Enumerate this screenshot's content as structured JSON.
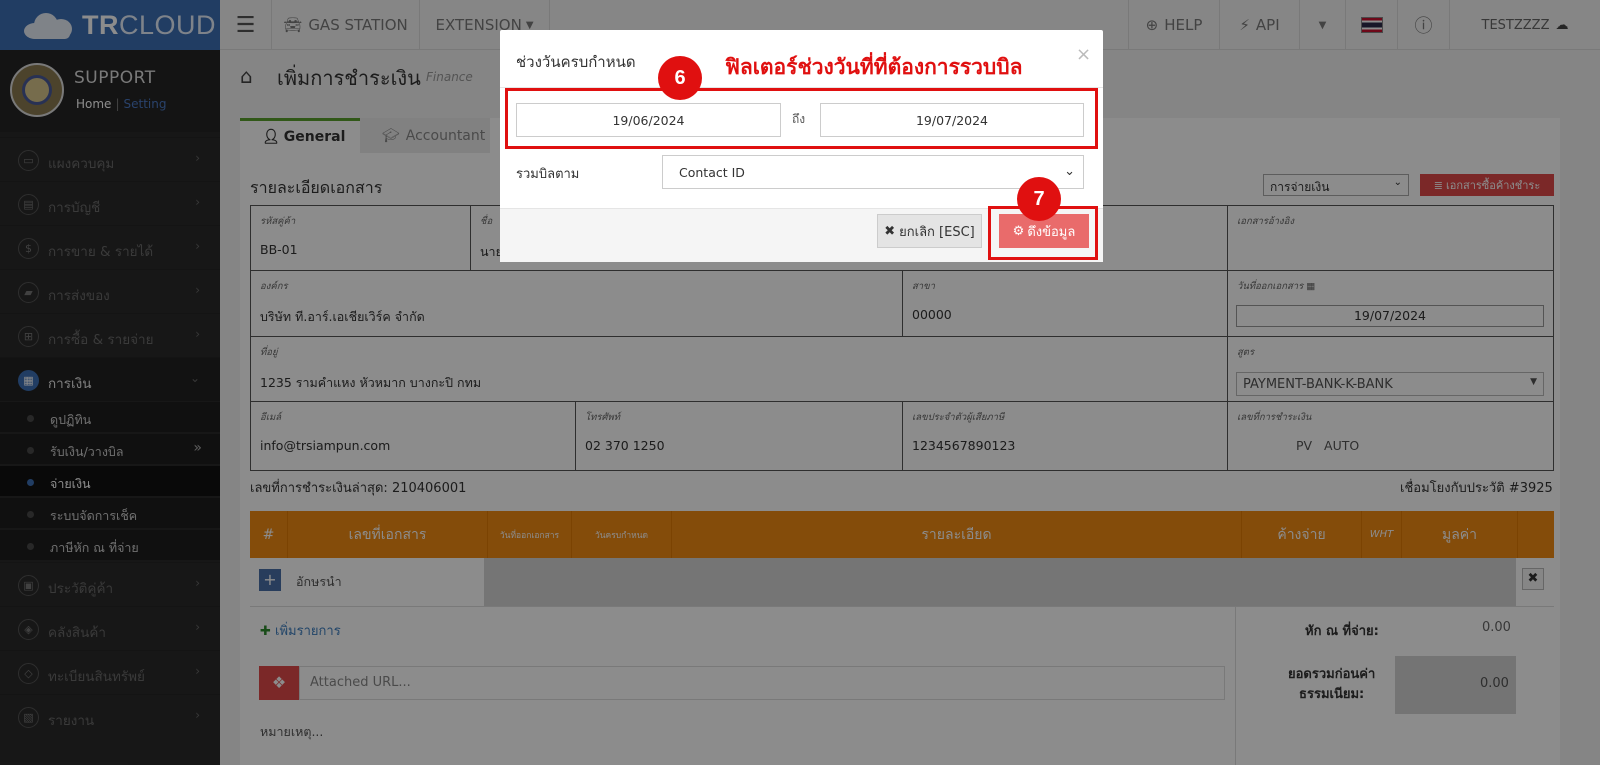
{
  "brand": {
    "bold": "TR",
    "light": "CLOUD"
  },
  "profile": {
    "name": "SUPPORT",
    "home": "Home",
    "separator": "|",
    "setting": "Setting"
  },
  "sidebar": {
    "menu": [
      {
        "label": "แผงควบคุม",
        "icon": "monitor-icon"
      },
      {
        "label": "การบัญชี",
        "icon": "book-icon"
      },
      {
        "label": "การขาย & รายได้",
        "icon": "dollar-icon"
      },
      {
        "label": "การส่งของ",
        "icon": "truck-icon"
      },
      {
        "label": "การซื้อ & รายจ่าย",
        "icon": "cart-icon"
      },
      {
        "label": "การเงิน",
        "icon": "calendar-icon"
      }
    ],
    "submenu": [
      "ดูปฏิทิน",
      "รับเงิน/วางบิล",
      "จ่ายเงิน",
      "ระบบจัดการเช็ค",
      "ภาษีหัก ณ ที่จ่าย"
    ],
    "menu_bottom": [
      {
        "label": "ประวัติคู่ค้า",
        "icon": "contact-icon"
      },
      {
        "label": "คลังสินค้า",
        "icon": "cubes-icon"
      },
      {
        "label": "ทะเบียนสินทรัพย์",
        "icon": "diamond-icon"
      },
      {
        "label": "รายงาน",
        "icon": "report-icon"
      }
    ]
  },
  "topbar": {
    "gas_station": "GAS STATION",
    "extension": "EXTENSION",
    "help": "HELP",
    "api": "API",
    "user": "TESTZZZZ"
  },
  "page": {
    "title": "เพิ่มการชำระเงิน",
    "subtitle": "Finance"
  },
  "tabs": {
    "general": "General",
    "accountant": "Accountant"
  },
  "doc": {
    "heading": "รายละเอียดเอกสาร",
    "payment_select": "การจ่ายเงิน",
    "unpaid_button": "เอกสารซื้อค้างชำระ",
    "contact_code_label": "รหัสคู่ค้า",
    "contact_code": "BB-01",
    "name_label": "ชื่อ",
    "name": "นาย",
    "ref_label": "เอกสารอ้างอิง",
    "org_label": "องค์กร",
    "org": "บริษัท ที.อาร์.เอเชียเวิร์ค จำกัด",
    "branch_label": "สาขา",
    "branch": "00000",
    "issue_date_label": "วันที่ออกเอกสาร",
    "issue_date": "19/07/2024",
    "address_label": "ที่อยู่",
    "address": "1235 รามคำแหง หัวหมาก บางกะปิ กทม",
    "formula_label": "สูตร",
    "formula": "PAYMENT-BANK-K-BANK",
    "email_label": "อีเมล์",
    "email": "info@trsiampun.com",
    "phone_label": "โทรศัพท์",
    "phone": "02 370 1250",
    "tax_label": "เลขประจำตัวผู้เสียภาษี",
    "tax": "1234567890123",
    "payno_label": "เลขที่การชำระเงิน",
    "payno_prefix": "PV",
    "payno_mode": "AUTO",
    "latest": "เลขที่การชำระเงินล่าสุด: 210406001",
    "linked": "เชื่อมโยงกับประวัติ #3925"
  },
  "table": {
    "headers": [
      "#",
      "เลขที่เอกสาร",
      "วันที่ออกเอกสาร",
      "วันครบกำหนด",
      "รายละเอียด",
      "ค้างจ่าย",
      "WHT",
      "มูลค่า"
    ],
    "prefix_label": "อักษรนำ",
    "add_item": "เพิ่มรายการ",
    "wht_label": "หัก ณ ที่จ่าย:",
    "wht_value": "0.00",
    "attached_placeholder": "Attached URL...",
    "pre_fee_label_1": "ยอดรวมก่อนค่า",
    "pre_fee_label_2": "ธรรมเนียม:",
    "pre_fee_value": "0.00",
    "note_placeholder": "หมายเหตุ..."
  },
  "modal": {
    "title": "ช่วงวันครบกำหนด",
    "annotation": "ฟิลเตอร์ช่วงวันที่ที่ต้องการรวบบิล",
    "date_from": "19/06/2024",
    "to_label": "ถึง",
    "date_to": "19/07/2024",
    "group_label": "รวมบิลตาม",
    "group_value": "Contact ID",
    "cancel": "ยกเลิก [ESC]",
    "fetch": "ดึงข้อมูล",
    "close": "×",
    "step_date": "6",
    "step_fetch": "7"
  },
  "colors": {
    "primary": "#3c6fb5",
    "header_orange": "#f08a13",
    "danger": "#e04a4a",
    "annotation_red": "#e01010"
  }
}
